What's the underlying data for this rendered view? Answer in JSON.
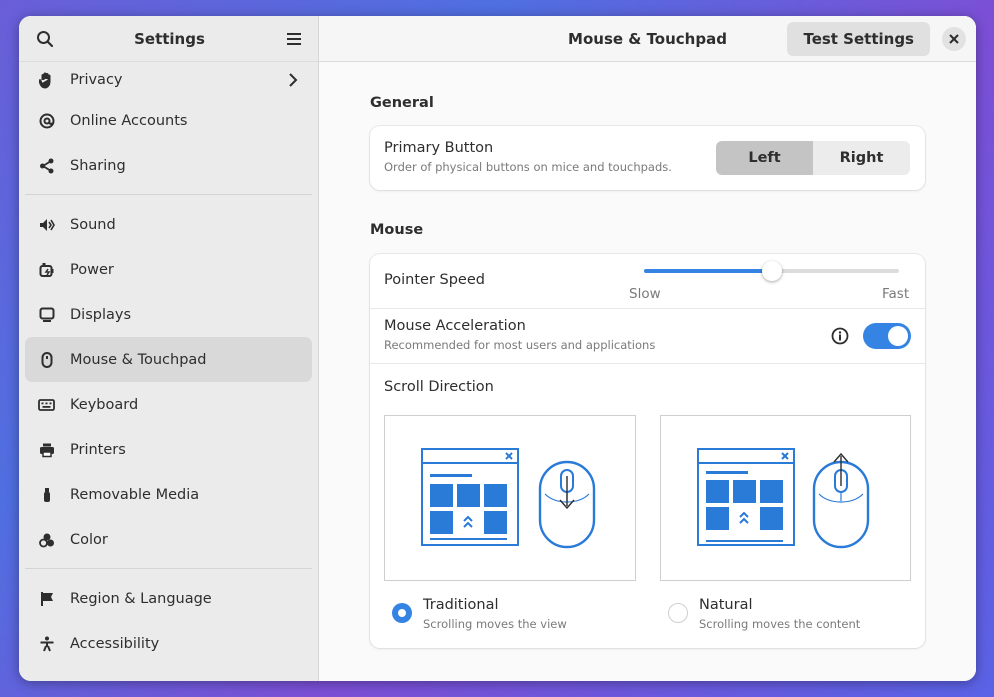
{
  "sidebar": {
    "title": "Settings",
    "items": [
      {
        "label": "Privacy",
        "icon": "hand-icon"
      },
      {
        "label": "Online Accounts",
        "icon": "at-icon"
      },
      {
        "label": "Sharing",
        "icon": "share-icon"
      },
      {
        "label": "Sound",
        "icon": "speaker-icon"
      },
      {
        "label": "Power",
        "icon": "power-icon"
      },
      {
        "label": "Displays",
        "icon": "display-icon"
      },
      {
        "label": "Mouse & Touchpad",
        "icon": "mouse-icon"
      },
      {
        "label": "Keyboard",
        "icon": "keyboard-icon"
      },
      {
        "label": "Printers",
        "icon": "printer-icon"
      },
      {
        "label": "Removable Media",
        "icon": "usb-icon"
      },
      {
        "label": "Color",
        "icon": "color-icon"
      },
      {
        "label": "Region & Language",
        "icon": "flag-icon"
      },
      {
        "label": "Accessibility",
        "icon": "accessibility-icon"
      }
    ]
  },
  "header": {
    "title": "Mouse & Touchpad",
    "test_button": "Test Settings"
  },
  "general": {
    "section_title": "General",
    "primary_button_title": "Primary Button",
    "primary_button_sub": "Order of physical buttons on mice and touchpads.",
    "left_label": "Left",
    "right_label": "Right",
    "selected": "Left"
  },
  "mouse": {
    "section_title": "Mouse",
    "pointer_speed_title": "Pointer Speed",
    "slow_label": "Slow",
    "fast_label": "Fast",
    "pointer_speed_value": 0.5,
    "accel_title": "Mouse Acceleration",
    "accel_sub": "Recommended for most users and applications",
    "accel_enabled": true,
    "scroll_title": "Scroll Direction",
    "traditional_title": "Traditional",
    "traditional_sub": "Scrolling moves the view",
    "natural_title": "Natural",
    "natural_sub": "Scrolling moves the content",
    "scroll_selected": "Traditional"
  },
  "colors": {
    "accent": "#3584e4",
    "illustration": "#2a7ad8"
  }
}
